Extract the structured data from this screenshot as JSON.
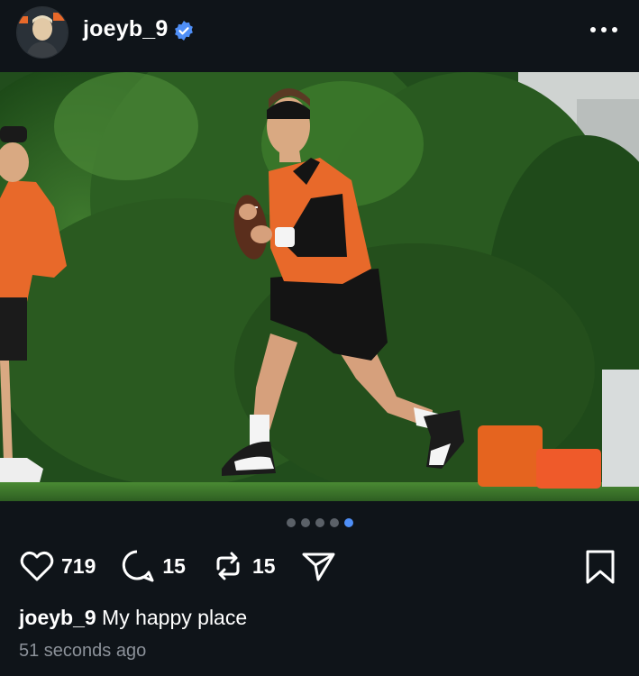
{
  "post": {
    "username": "joeyb_9",
    "verified": true,
    "caption_user": "joeyb_9",
    "caption_text": "My happy place",
    "timestamp": "51 seconds ago"
  },
  "carousel": {
    "total": 5,
    "active_index": 4
  },
  "actions": {
    "likes": "719",
    "comments": "15",
    "reposts": "15"
  },
  "icons": {
    "more": "more-horizontal-icon",
    "like": "heart-icon",
    "comment": "comment-bubble-icon",
    "repost": "repost-arrows-icon",
    "share": "send-icon",
    "save": "bookmark-icon",
    "verified": "verified-badge-icon"
  },
  "colors": {
    "background": "#0f1419",
    "accent": "#4f8ff7",
    "jersey": "#e8692a"
  }
}
